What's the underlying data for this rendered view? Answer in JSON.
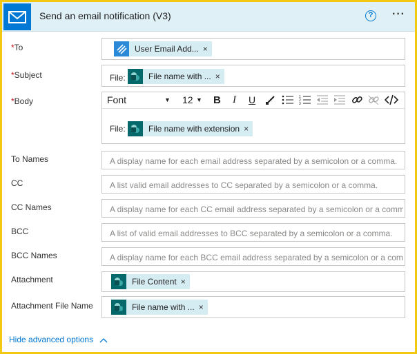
{
  "header": {
    "title": "Send an email notification (V3)",
    "help_icon": "question-circle-icon",
    "more_icon": "ellipsis-icon",
    "brand_color": "#0078d4",
    "border_color": "#f2c811"
  },
  "fields": {
    "to": {
      "label": "To",
      "required_mark": "*",
      "token": "User Email Add..."
    },
    "subject": {
      "label": "Subject",
      "required_mark": "*",
      "prefix": "File:",
      "token": "File name with ..."
    },
    "body": {
      "label": "Body",
      "required_mark": "*",
      "toolbar": {
        "font": "Font",
        "size": "12",
        "bold": "B",
        "italic": "I",
        "underline": "U"
      },
      "prefix": "File:",
      "token": "File name with extension"
    },
    "to_names": {
      "label": "To Names",
      "placeholder": "A display name for each email address separated by a semicolon or a comma."
    },
    "cc": {
      "label": "CC",
      "placeholder": "A list valid email addresses to CC separated by a semicolon or a comma."
    },
    "cc_names": {
      "label": "CC Names",
      "placeholder": "A display name for each CC email address separated by a semicolon or a comma."
    },
    "bcc": {
      "label": "BCC",
      "placeholder": "A list of valid email addresses to BCC separated by a semicolon or a comma."
    },
    "bcc_names": {
      "label": "BCC Names",
      "placeholder": "A display name for each BCC email address separated by a semicolon or a comma."
    },
    "attachment": {
      "label": "Attachment",
      "token": "File Content"
    },
    "attachment_name": {
      "label": "Attachment File Name",
      "token": "File name with ..."
    }
  },
  "token_remove": "×",
  "advanced_link": "Hide advanced options",
  "advanced_icon": "chevron-up-icon"
}
